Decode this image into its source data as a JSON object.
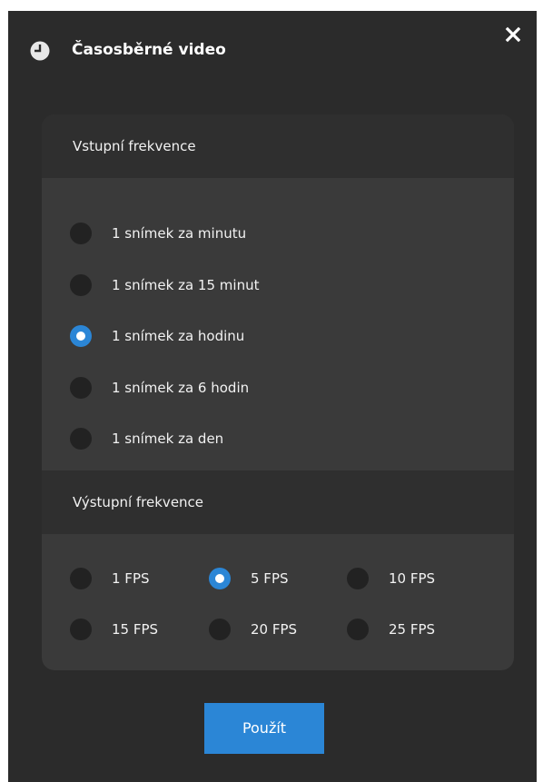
{
  "dialog": {
    "title": "Časosběrné video",
    "title_icon": "clock-icon",
    "close_icon": "close-icon"
  },
  "input_frequency": {
    "header": "Vstupní frekvence",
    "options": [
      {
        "label": "1 snímek za minutu",
        "selected": false
      },
      {
        "label": "1 snímek za 15 minut",
        "selected": false
      },
      {
        "label": "1 snímek za hodinu",
        "selected": true
      },
      {
        "label": "1 snímek za 6 hodin",
        "selected": false
      },
      {
        "label": "1 snímek za den",
        "selected": false
      }
    ]
  },
  "output_frequency": {
    "header": "Výstupní frekvence",
    "options": [
      {
        "label": "1 FPS",
        "selected": false
      },
      {
        "label": "5 FPS",
        "selected": true
      },
      {
        "label": "10 FPS",
        "selected": false
      },
      {
        "label": "15 FPS",
        "selected": false
      },
      {
        "label": "20 FPS",
        "selected": false
      },
      {
        "label": "25 FPS",
        "selected": false
      }
    ]
  },
  "apply_button": {
    "label": "Použít"
  },
  "colors": {
    "accent": "#2b86d6",
    "dialog_bg": "#2b2b2b",
    "panel_bg": "#3a3a3a"
  }
}
